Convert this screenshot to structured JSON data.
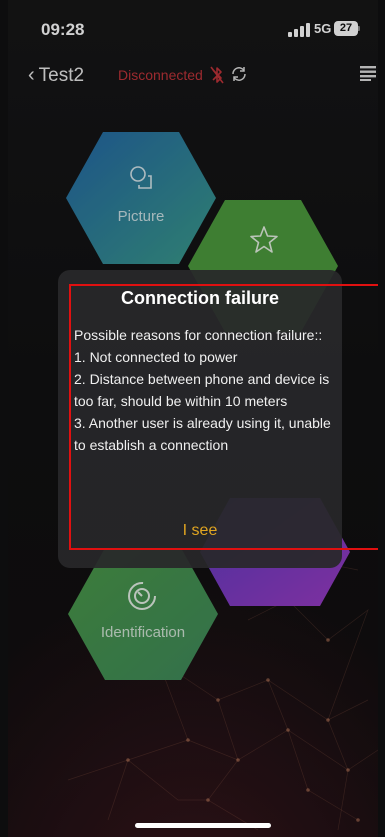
{
  "status_bar": {
    "time": "09:28",
    "network": "5G",
    "battery": "27"
  },
  "nav": {
    "back_label": "Test2",
    "connection_status": "Disconnected",
    "status_color": "#c0343a"
  },
  "tiles": [
    {
      "name": "picture",
      "label": "Picture",
      "icon": "picture-icon",
      "color": "#2f6ea8"
    },
    {
      "name": "effects",
      "label": "",
      "icon": "star-icon",
      "color": "#4f9a3a"
    },
    {
      "name": "identification",
      "label": "Identification",
      "icon": "target-icon",
      "color": "#4a9a4e"
    },
    {
      "name": "purple-tile",
      "label": "",
      "icon": "",
      "color": "#7a3cc7"
    }
  ],
  "dialog": {
    "title": "Connection failure",
    "lines": [
      "Possible reasons for connection failure::",
      "1. Not connected to power",
      "2. Distance between phone and device is too far, should be within 10 meters",
      "3. Another user is already using it, unable to establish a connection"
    ],
    "button": "I see",
    "button_color": "#e0a521",
    "highlight_color": "#e01010"
  }
}
